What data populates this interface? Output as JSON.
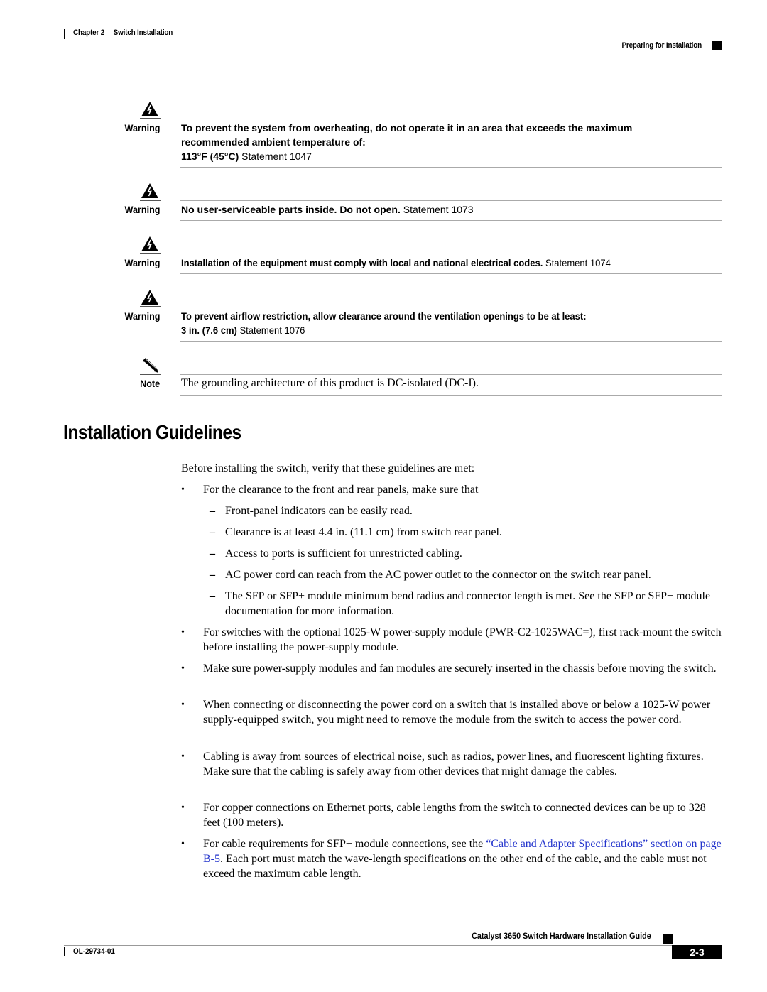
{
  "header": {
    "chapter": "Chapter 2",
    "chapter_title": "Switch Installation",
    "section": "Preparing for Installation"
  },
  "admonitions": [
    {
      "type": "Warning",
      "icon": "warning-lightning-icon",
      "bold_line1": "To prevent the system from overheating, do not operate it in an area that exceeds the maximum",
      "bold_line2": "recommended ambient temperature of:",
      "bold_value": "113°F (45°C)",
      "statement": "Statement 1047"
    },
    {
      "type": "Warning",
      "icon": "warning-lightning-icon",
      "bold_text": "No user-serviceable parts inside. Do not open.",
      "statement": "Statement 1073"
    },
    {
      "type": "Warning",
      "icon": "warning-lightning-icon",
      "bold_text": "Installation of the equipment must comply with local and national electrical codes.",
      "statement": "Statement 1074"
    },
    {
      "type": "Warning",
      "icon": "warning-lightning-icon",
      "bold_line1": "To prevent airflow restriction, allow clearance around the ventilation openings to be at least:",
      "bold_value": "3 in. (7.6 cm)",
      "statement": "Statement 1076"
    },
    {
      "type": "Note",
      "icon": "note-pencil-icon",
      "text": "The grounding architecture of this product is DC-isolated (DC-I)."
    }
  ],
  "section": {
    "title": "Installation Guidelines",
    "intro": "Before installing the switch, verify that these guidelines are met:",
    "items": [
      {
        "text": "For the clearance to the front and rear panels, make sure that",
        "subitems": [
          "Front-panel indicators can be easily read.",
          "Clearance is at least 4.4 in. (11.1 cm) from switch rear panel.",
          "Access to ports is sufficient for unrestricted cabling.",
          "AC power cord can reach from the AC power outlet to the connector on the switch rear panel.",
          "The SFP or SFP+ module minimum bend radius and connector length is met. See the SFP or SFP+ module documentation for more information."
        ]
      },
      {
        "text": "For switches with the optional 1025-W power-supply module (PWR-C2-1025WAC=), first rack-mount the switch before installing the power-supply module."
      },
      {
        "text": "Make sure power-supply modules and fan modules are securely inserted in the chassis before moving the switch."
      },
      {
        "text": "When connecting or disconnecting the power cord on a switch that is installed above or below a 1025-W power supply-equipped switch, you might need to remove the module from the switch to access the power cord."
      },
      {
        "text": "Cabling is away from sources of electrical noise, such as radios, power lines, and fluorescent lighting fixtures. Make sure that the cabling is safely away from other devices that might damage the cables."
      },
      {
        "text": "For copper connections on Ethernet ports, cable lengths from the switch to connected devices can be up to 328 feet (100 meters)."
      },
      {
        "text_before": "For cable requirements for SFP+ module connections, see the ",
        "link": "“Cable and Adapter Specifications” section on page B-5",
        "text_after": ". Each port must match the wave-length specifications on the other end of the cable, and the cable must not exceed the maximum cable length."
      }
    ],
    "bullet": "•",
    "dash": "–"
  },
  "footer": {
    "guide_title": "Catalyst 3650 Switch Hardware Installation Guide",
    "doc_number": "OL-29734-01",
    "page": "2-3"
  },
  "colors": {
    "link": "#2233cc",
    "text": "#000000",
    "rule": "#aaaaaa"
  }
}
